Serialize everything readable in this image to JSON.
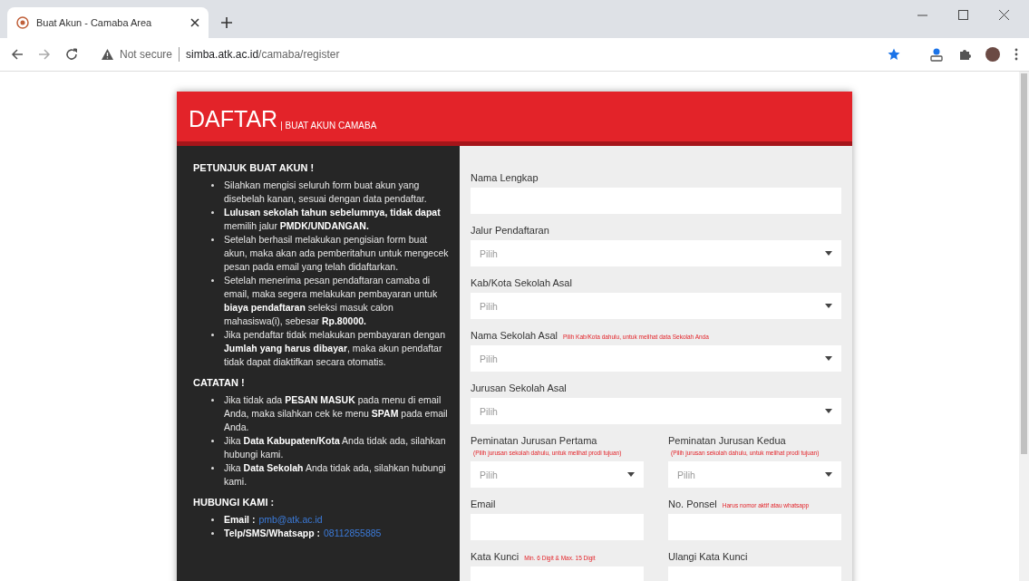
{
  "browser": {
    "tab_title": "Buat Akun - Camaba Area",
    "security": "Not secure",
    "url_host": "simba.atk.ac.id",
    "url_path": "/camaba/register"
  },
  "header": {
    "title": "DAFTAR",
    "subtitle": "| BUAT AKUN CAMABA"
  },
  "instructions": [
    {
      "kind": "list",
      "heading": "PETUNJUK BUAT AKUN !",
      "items": [
        "Silahkan mengisi seluruh form buat akun yang disebelah kanan, sesuai dengan data pendaftar.",
        "**Lulusan sekolah tahun sebelumnya, tidak dapat** memilih jalur **PMDK/UNDANGAN.**",
        "Setelah berhasil melakukan pengisian form buat akun, maka akan ada pemberitahun untuk mengecek pesan pada email yang telah didaftarkan.",
        "Setelah menerima pesan pendaftaran camaba di email, maka segera melakukan pembayaran untuk **biaya pendaftaran** seleksi masuk calon mahasiswa(i), sebesar **Rp.80000.**",
        "Jika pendaftar tidak melakukan pembayaran dengan **Jumlah yang harus dibayar**, maka akun pendaftar tidak dapat diaktifkan secara otomatis."
      ]
    },
    {
      "kind": "list",
      "heading": "CATATAN !",
      "items": [
        "Jika tidak ada **PESAN MASUK** pada menu di email Anda, maka silahkan cek ke menu **SPAM** pada email Anda.",
        "Jika **Data Kabupaten/Kota** Anda tidak ada, silahkan hubungi kami.",
        "Jika **Data Sekolah** Anda tidak ada, silahkan hubungi kami."
      ]
    },
    {
      "kind": "contacts",
      "heading": "HUBUNGI KAMI :",
      "items": [
        {
          "label": "Email :",
          "value": "pmb@atk.ac.id"
        },
        {
          "label": "Telp/SMS/Whatsapp :",
          "value": "08112855885"
        }
      ]
    }
  ],
  "form": [
    {
      "fields": [
        {
          "kind": "text",
          "label": "Nama Lengkap"
        }
      ]
    },
    {
      "fields": [
        {
          "kind": "select",
          "label": "Jalur Pendaftaran",
          "placeholder": "Pilih"
        }
      ]
    },
    {
      "fields": [
        {
          "kind": "select",
          "label": "Kab/Kota Sekolah Asal",
          "placeholder": "Pilih"
        }
      ]
    },
    {
      "fields": [
        {
          "kind": "select",
          "label": "Nama Sekolah Asal",
          "hint": "Pilih Kab/Kota dahulu, untuk melihat data Sekolah Anda",
          "placeholder": "Pilih"
        }
      ]
    },
    {
      "fields": [
        {
          "kind": "select",
          "label": "Jurusan Sekolah Asal",
          "placeholder": "Pilih"
        }
      ]
    },
    {
      "fields": [
        {
          "kind": "select",
          "label": "Peminatan Jurusan Pertama",
          "hint": "(Pilih jurusan sekolah dahulu, untuk melihat prodi tujuan)",
          "placeholder": "Pilih"
        },
        {
          "kind": "select",
          "label": "Peminatan Jurusan Kedua",
          "hint": "(Pilih jurusan sekolah dahulu, untuk melihat prodi tujuan)",
          "placeholder": "Pilih"
        }
      ]
    },
    {
      "fields": [
        {
          "kind": "text",
          "label": "Email"
        },
        {
          "kind": "text",
          "label": "No. Ponsel",
          "hint": "Harus nomor aktif atau whatsapp"
        }
      ]
    },
    {
      "fields": [
        {
          "kind": "text",
          "label": "Kata Kunci",
          "hint": "Min. 6 Digit & Max. 15 Digit"
        },
        {
          "kind": "text",
          "label": "Ulangi Kata Kunci"
        }
      ]
    }
  ]
}
